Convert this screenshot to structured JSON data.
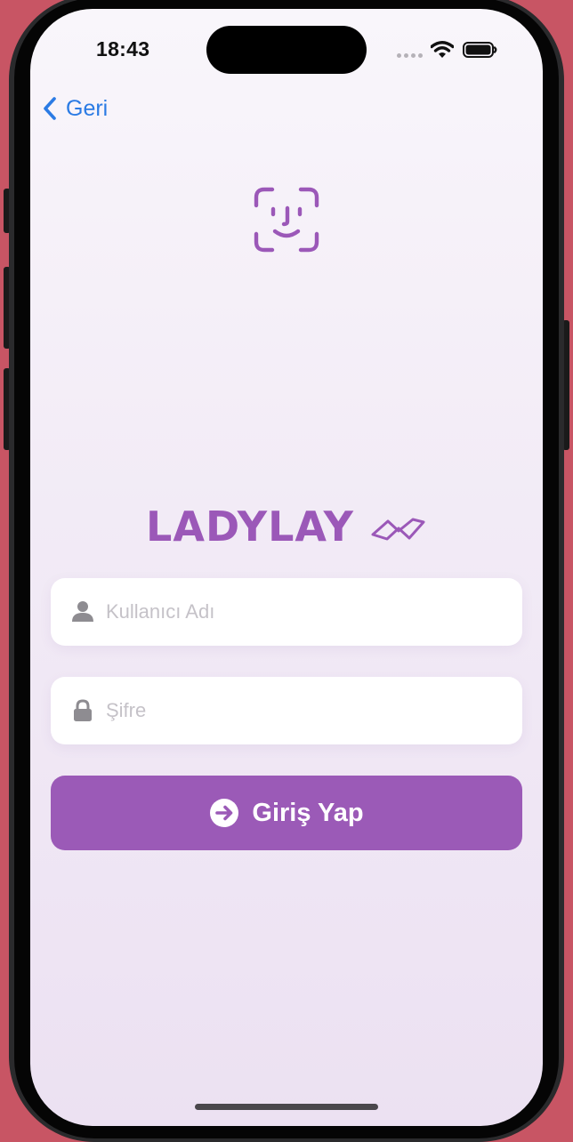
{
  "status_bar": {
    "time": "18:43",
    "icons": [
      "signal-dots-icon",
      "wifi-icon",
      "battery-icon"
    ]
  },
  "nav": {
    "back_label": "Geri",
    "back_icon": "chevron-left-icon"
  },
  "hero": {
    "icon": "face-id-icon",
    "icon_color": "#9b58b8"
  },
  "brand": {
    "name": "LADYLAY",
    "logo_icon": "zigzag-wave-icon",
    "color": "#9b58b8"
  },
  "form": {
    "username": {
      "placeholder": "Kullanıcı Adı",
      "value": "",
      "icon": "person-icon"
    },
    "password": {
      "placeholder": "Şifre",
      "value": "",
      "icon": "lock-icon"
    },
    "submit": {
      "label": "Giriş Yap",
      "icon": "arrow-right-circle-icon",
      "color": "#9b5ab7"
    }
  },
  "colors": {
    "accent": "#9b58b8",
    "link": "#2b7be4",
    "device_background": "#c85564"
  }
}
